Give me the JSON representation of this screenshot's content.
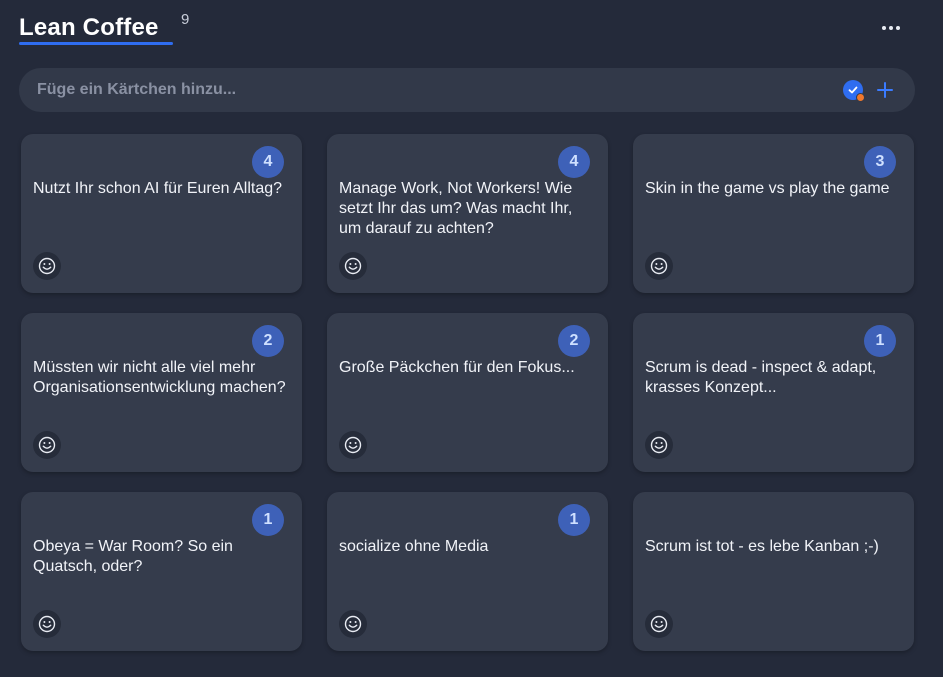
{
  "header": {
    "title": "Lean Coffee",
    "count": "9"
  },
  "add_card": {
    "placeholder": "Füge ein Kärtchen hinzu...",
    "value": ""
  },
  "colors": {
    "background": "#242a3a",
    "card": "#353c4c",
    "accent": "#2f6df0",
    "vote_badge": "#3e61b8",
    "status_dot": "#f0782c"
  },
  "cards": [
    {
      "votes": "4",
      "text": "Nutzt Ihr schon AI für Euren Alltag?"
    },
    {
      "votes": "4",
      "text": "Manage Work, Not Workers! Wie setzt Ihr das um? Was macht Ihr, um darauf zu achten?"
    },
    {
      "votes": "3",
      "text": "Skin in the game vs play the game"
    },
    {
      "votes": "2",
      "text": "Müssten wir nicht alle viel mehr Organisationsentwicklung machen?"
    },
    {
      "votes": "2",
      "text": "Große Päckchen für den Fokus..."
    },
    {
      "votes": "1",
      "text": "Scrum is dead - inspect & adapt, krasses Konzept..."
    },
    {
      "votes": "1",
      "text": "Obeya = War Room? So ein Quatsch, oder?"
    },
    {
      "votes": "1",
      "text": "socialize ohne Media"
    },
    {
      "votes": "",
      "text": "Scrum ist tot - es lebe Kanban ;-)"
    }
  ],
  "icons": {
    "more": "more-horizontal-icon",
    "check": "check-badge-icon",
    "add": "plus-icon",
    "reaction": "smiley-icon"
  }
}
